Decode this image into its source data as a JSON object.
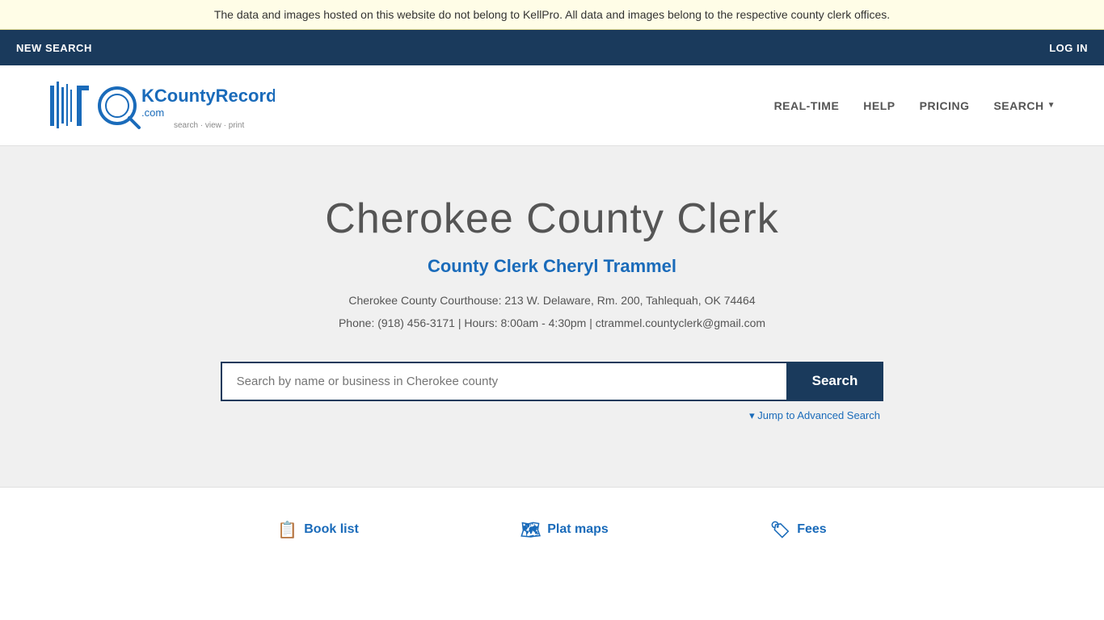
{
  "banner": {
    "text": "The data and images hosted on this website do not belong to KellPro. All data and images belong to the respective county clerk offices."
  },
  "nav": {
    "new_search_label": "NEW SEARCH",
    "log_in_label": "LOG IN"
  },
  "header": {
    "logo_alt": "OKCountyRecords.com",
    "logo_tagline": "search · view · print",
    "nav_items": [
      {
        "label": "REAL-TIME",
        "href": "#"
      },
      {
        "label": "HELP",
        "href": "#"
      },
      {
        "label": "PRICING",
        "href": "#"
      },
      {
        "label": "SEARCH",
        "href": "#"
      }
    ]
  },
  "main": {
    "county_title": "Cherokee County Clerk",
    "clerk_name": "County Clerk Cheryl Trammel",
    "courthouse_line1": "Cherokee County Courthouse: 213 W. Delaware, Rm. 200, Tahlequah, OK 74464",
    "courthouse_line2": "Phone: (918) 456-3171 | Hours: 8:00am - 4:30pm | ctrammel.countyclerk@gmail.com",
    "search_placeholder": "Search by name or business in Cherokee county",
    "search_button_label": "Search",
    "advanced_search_label": "▾ Jump to Advanced Search"
  },
  "footer": {
    "links": [
      {
        "label": "Book list",
        "icon": "📋"
      },
      {
        "label": "Plat maps",
        "icon": "🗺"
      },
      {
        "label": "Fees",
        "icon": "🏷"
      }
    ]
  }
}
